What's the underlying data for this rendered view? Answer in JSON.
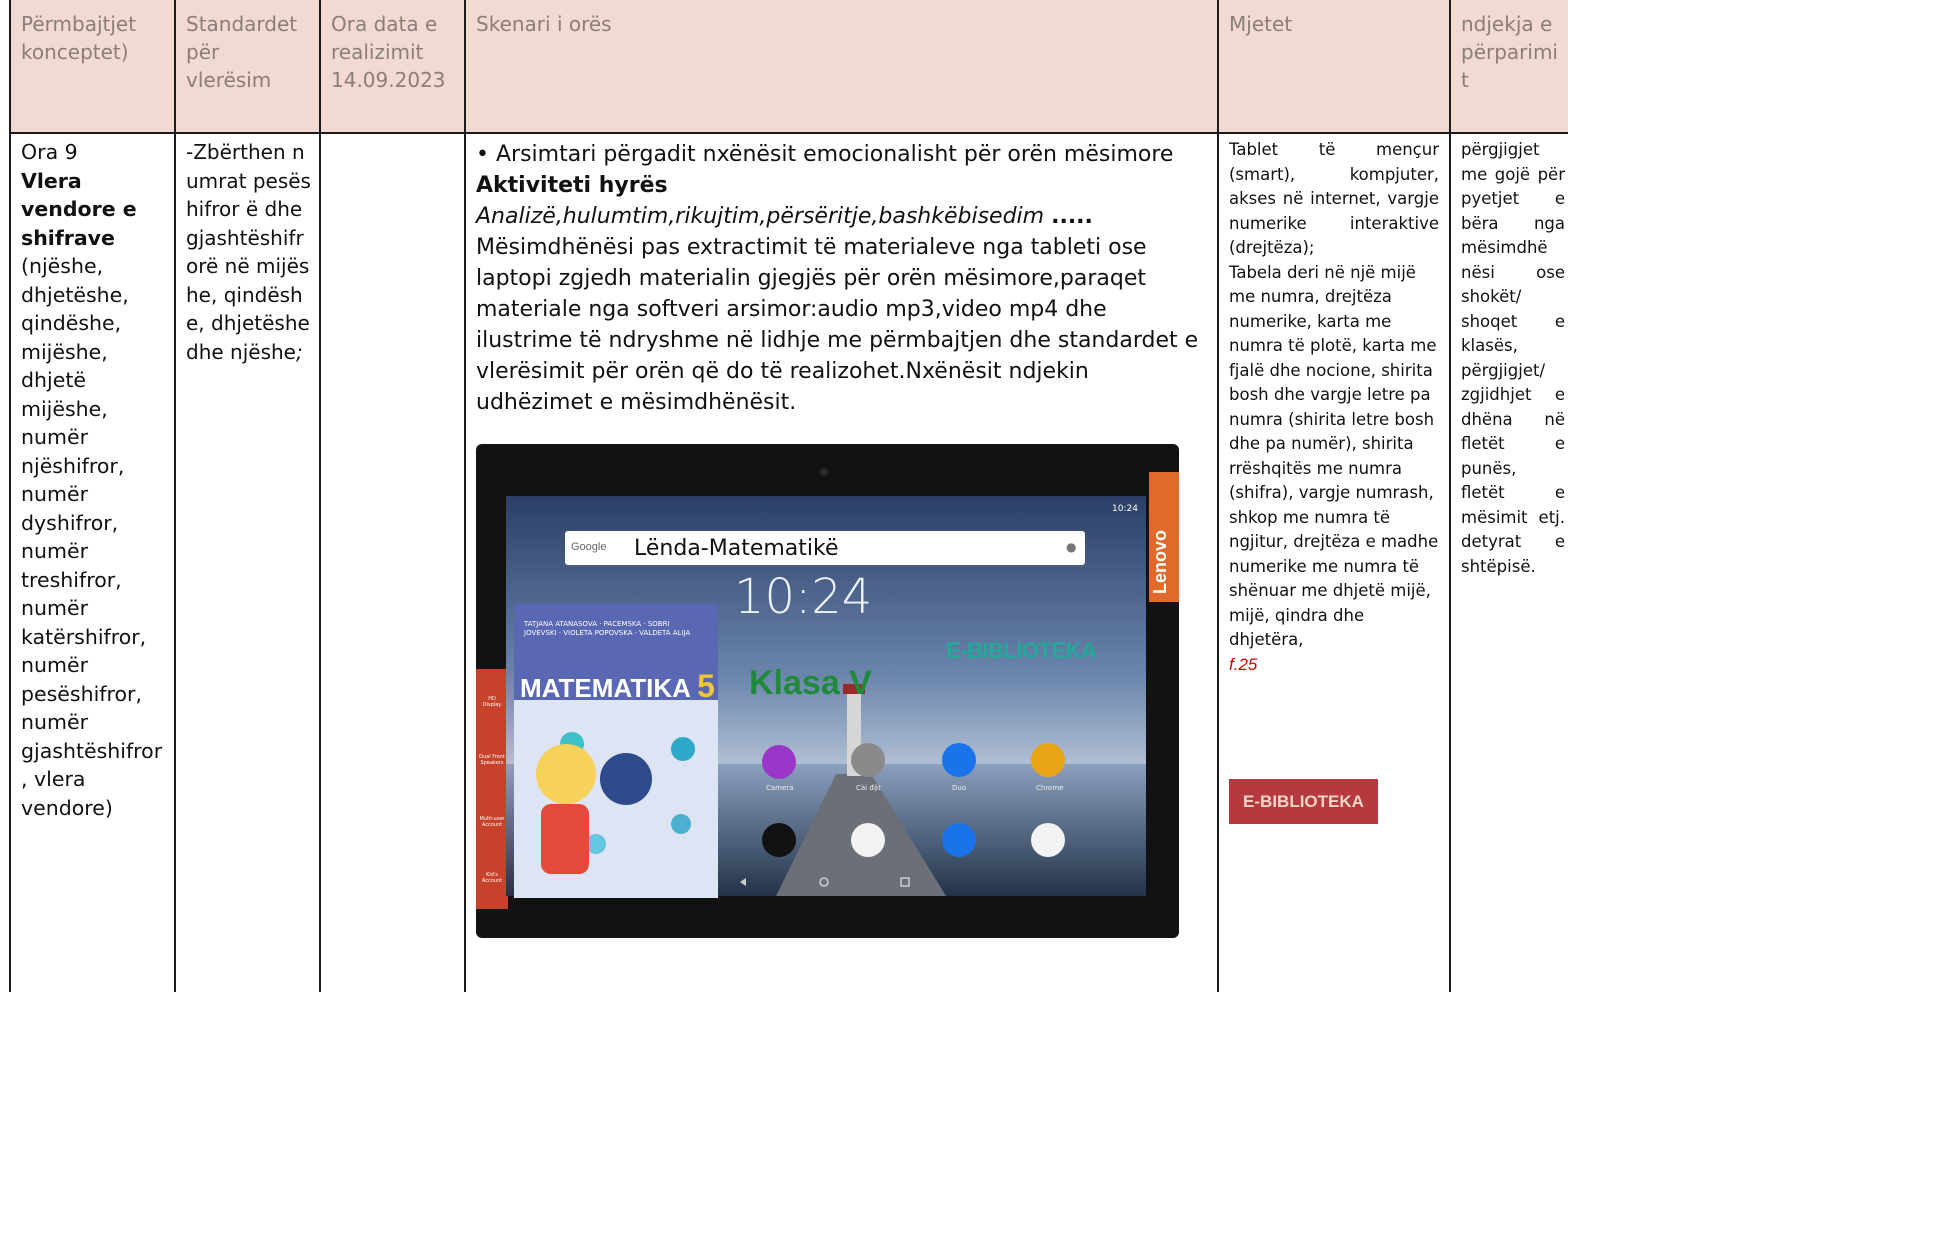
{
  "header": {
    "col1": "Përmbajtjet konceptet)",
    "col2": "Standardet për vlerësim",
    "col3": "Ora data e realizimit 14.09.2023",
    "col4": "Skenari i orës",
    "col5": "Mjetet",
    "col6": "ndjekja e përparimi t"
  },
  "col1": {
    "lesson": "Ora 9",
    "title": "Vlera vendore e shifrave",
    "body": "(njëshe, dhjetëshe, qindëshe, mijëshe, dhjetë mijëshe, numër njëshifror, numër dyshifror, numër treshifror, numër katërshifror, numër pesëshifror, numër gjashtëshifror , vlera vendore)"
  },
  "col2": {
    "text": "-Zbërthen numrat pesëshifror ë dhe gjashtëshifr orë në mijëshe, qindëshe, dhjetëshe dhe njëshe",
    "tail": ";"
  },
  "col4": {
    "bullet": "• Arsimtari përgadit nxënësit emocionalisht për orën mësimore",
    "activity": "Aktiviteti hyrës",
    "methods": "Analizë,hulumtim,rikujtim,përsëritje,bashkëbisedim",
    "dots": ".....",
    "paragraph": "Mësimdhënësi pas extractimit të materialeve nga tableti ose laptopi zgjedh materialin gjegjës për orën mësimore,paraqet materiale nga softveri arsimor:audio mp3,video mp4 dhe ilustrime të ndryshme në lidhje me përmbajtjen dhe standardet e vlerësimit për orën që do të realizohet.Nxënësit ndjekin udhëzimet e mësimdhënësit."
  },
  "tablet": {
    "brand": "Lenovo",
    "search_logo": "Google",
    "search_text": "Lënda-Matematikë",
    "clock": "10:24",
    "status_time": "10:24",
    "ebib": "E-BIBLIOTEKA",
    "klasa": "Klasa V",
    "book_authors": "TATJANA ATANASOVA · PACEMSKA · SOBRI JOVEVSKI · VIOLETA POPOVSKA · VALDETA ALIJA",
    "book_title": "MATEMATIKA",
    "book_number": "5",
    "app_labels": [
      "Camera",
      "Cài đặt",
      "Duo",
      "Chrome"
    ],
    "side_features": [
      "HD Display",
      "Dual Front Speakers",
      "Multi-user Account",
      "Kid's Account"
    ]
  },
  "col5": {
    "text1": "Tablet të mençur (smart), kompjuter, akses në internet, vargje numerike interaktive (drejtëza);",
    "text2": "Tabela deri në një mijë me numra, drejtëza numerike, karta me numra të plotë, karta me fjalë dhe nocione, shirita bosh dhe vargje letre pa numra (shirita letre bosh dhe pa numër), shirita rrëshqitës me numra (shifra), vargje numrash, shkop me numra të ngjitur, drejtëza e madhe numerike me numra të shënuar me dhjetë mijë, mijë, qindra dhe dhjetëra,",
    "page_ref": "f.25",
    "ebib": "E-BIBLIOTEKA"
  },
  "col6": {
    "text": "përgjigjet me gojë për pyetjet e bëra nga mësimdhë nësi ose shokët/ shoqet e klasës, përgjigjet/ zgjidhjet e dhëna në fletët e punës, fletët e mësimit etj. detyrat e shtëpisë."
  },
  "colors": {
    "header_bg": "#f2d9d2",
    "header_text": "#8a7d7a",
    "grid_line": "#1a1a1a",
    "page_ref": "#d40000",
    "ebib_bg": "#b5393f",
    "ebib_teal": "#23a99a",
    "klasa_green": "#1f8a3a",
    "lenovo_orange": "#e06a2a"
  }
}
